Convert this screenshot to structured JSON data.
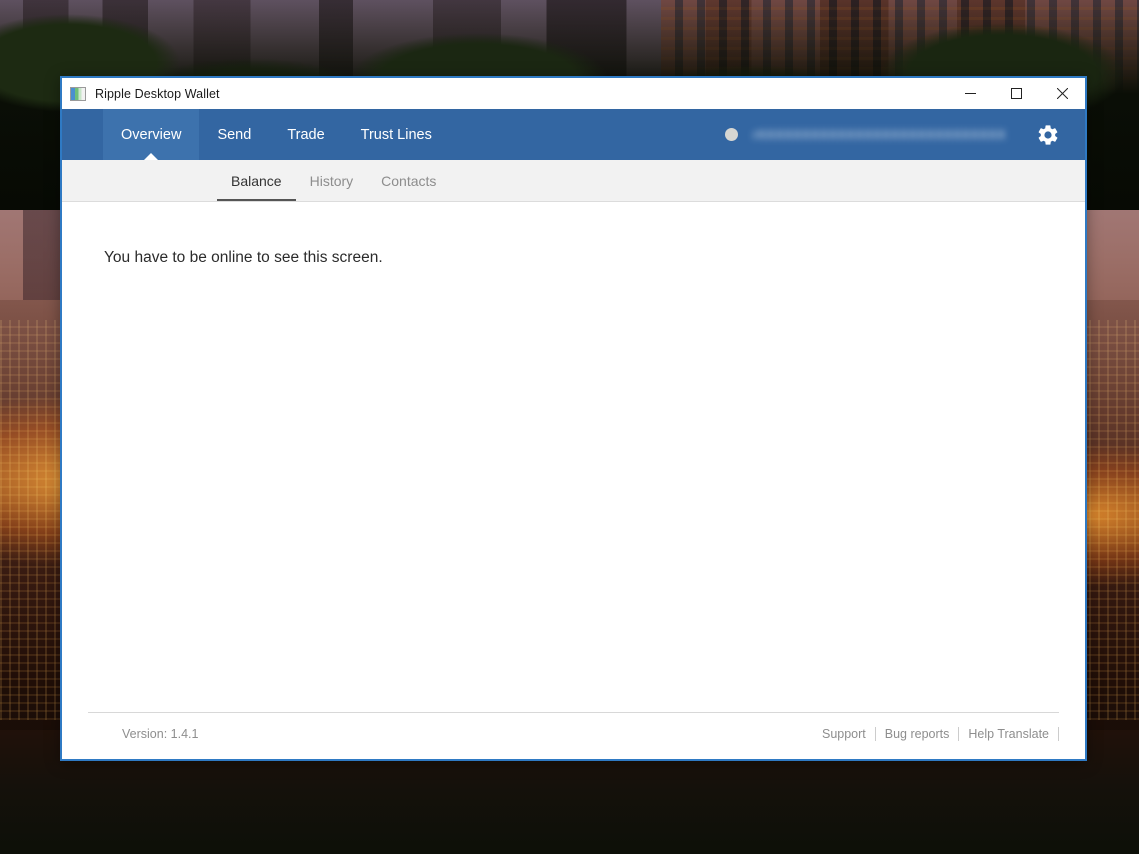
{
  "window": {
    "title": "Ripple Desktop Wallet",
    "app_icon": "app-logo-icon",
    "controls": {
      "minimize": "minimize-icon",
      "maximize": "maximize-icon",
      "close": "close-icon"
    }
  },
  "navbar": {
    "tabs": [
      {
        "label": "Overview",
        "active": true
      },
      {
        "label": "Send",
        "active": false
      },
      {
        "label": "Trade",
        "active": false
      },
      {
        "label": "Trust Lines",
        "active": false
      }
    ],
    "status_indicator": "offline-status-dot",
    "account_address": "rXXXXXXXXXXXXXXXXXXXXXXXXXXXXXXXXX",
    "settings_icon": "gear-icon"
  },
  "subbar": {
    "tabs": [
      {
        "label": "Balance",
        "active": true
      },
      {
        "label": "History",
        "active": false
      },
      {
        "label": "Contacts",
        "active": false
      }
    ]
  },
  "content": {
    "message": "You have to be online to see this screen."
  },
  "footer": {
    "version": "Version: 1.4.1",
    "links": [
      "Support",
      "Bug reports",
      "Help Translate"
    ]
  },
  "colors": {
    "navbar_blue": "#3366a2",
    "navbar_active_tab": "#3d72ad",
    "window_border": "#2f7ac4",
    "subbar_bg": "#f2f2f2",
    "muted_text": "#8e8e8e"
  }
}
